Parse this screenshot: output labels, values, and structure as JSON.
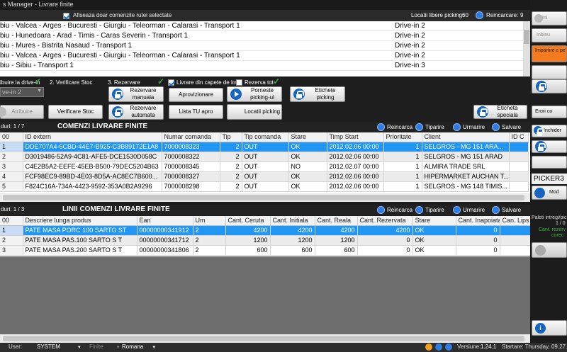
{
  "window": {
    "title": "s Manager - Livrare finite"
  },
  "topbar": {
    "show_selected_only_label": "Afiseaza doar comenzile rutei selectate",
    "free_picking_locations_label": "Locatii libere picking:",
    "free_picking_locations_value": "60",
    "reload_label": "Reincarcare:",
    "reload_value": "9"
  },
  "routes": [
    {
      "route": "biu - Valcea - Arges - Bucuresti - Giurgiu - Teleorman - Calarasi - Transport 1",
      "dock": "Drive-in 2"
    },
    {
      "route": "biu - Hunedoara - Arad - Timis - Caras Severin - Transport 1",
      "dock": "Drive-in 2"
    },
    {
      "route": "biu - Mures - Bistrita Nasaud    - Transport 1",
      "dock": "Drive-in 2"
    },
    {
      "route": "biu - Valcea - Arges - Bucuresti - Giurgiu - Teleorman - Calarasi - Transport 1",
      "dock": "Drive-in 2"
    },
    {
      "route": "biu - Sibiu  - Transport 1",
      "dock": "Drive-in 3"
    },
    {
      "route": "",
      "dock": ""
    }
  ],
  "steps": {
    "step1_label": "ibuire la drive-in",
    "dock_select_value": "ve-in 2",
    "assign_button": "Atribuire",
    "step2_label": "2. Verificare Stoc",
    "check_stock_button": "Verificare Stoc",
    "step3_label": "3. Rezervare",
    "manual_reservation_button": "Rezervare manuala",
    "auto_reservation_button": "Rezervare automata",
    "lot_delivery_label": "Livrare din capete de lot",
    "reserve_all_label": "Rezerva tot",
    "supply_button": "Aprovizionare",
    "tu_list_button": "Lista TU apro",
    "start_picking_button": "Porneste picking-ul",
    "picking_locations_button": "Locatii picking",
    "picking_labels_button": "Etichete picking",
    "special_label_button": "Eticheta speciala"
  },
  "orders": {
    "count_label": "duri:  1  /  7",
    "title": "COMENZI LIVRARE FINITE",
    "tools": [
      "Reincarca",
      "Tiparire",
      "Urmarire",
      "Salvare"
    ],
    "columns": [
      "00",
      "ID extern",
      "Numar comanda",
      "Tip",
      "Tip comanda",
      "Stare",
      "Timp Start",
      "Prioritate",
      "Client",
      "ID C"
    ],
    "rows": [
      [
        "1",
        "DDE707A4-6CBD-44E7-B925-C3B89172E1A8",
        "7000008323",
        "2",
        "OUT",
        "OK",
        "2012.02.06 00:00",
        "1",
        "SELGROS - MG 151 ARA..."
      ],
      [
        "2",
        "D3019486-52A9-4C81-AFE5-DCE1530D058C",
        "7000008322",
        "2",
        "OUT",
        "OK",
        "2012.02.06 00:00",
        "1",
        "SELGROS - MG 151 ARAD"
      ],
      [
        "3",
        "C4E2B5A2-EEFE-45EB-B500-79DEC5204B63",
        "7000008345",
        "2",
        "OUT",
        "NO",
        "2012.02.07 00:00",
        "1",
        "ALMIRA TRADE SRL"
      ],
      [
        "4",
        "FCF98EC9-89BD-4E03-8D5A-AC8EC7B600...",
        "7000008327",
        "2",
        "OUT",
        "OK",
        "2012.02.06 00:00",
        "1",
        "HIPERMARKET AUCHAN T..."
      ],
      [
        "5",
        "F824C16A-734A-4423-9592-353A0B2A9296",
        "7000008298",
        "2",
        "OUT",
        "OK",
        "2012.02.06 00:00",
        "1",
        "SELGROS - MG 148 TIMIS..."
      ]
    ]
  },
  "lines": {
    "count_label": "duri:  1  /  3",
    "title": "LINII COMENZI LIVRARE FINITE",
    "tools": [
      "Reincarca",
      "Tiparire",
      "Urmarire",
      "Salvare"
    ],
    "columns": [
      "00",
      "Descriere lunga produs",
      "Ean",
      "Um",
      "Cant. Ceruta",
      "Cant. Initiala",
      "Cant. Reala",
      "Cant. Rezervata",
      "Stare",
      "Cant. Inapoiata",
      "Can. Lips"
    ],
    "rows": [
      [
        "1",
        "PATE MASA PORC 100 SARTO ST",
        "00000000341912",
        "2",
        "4200",
        "4200",
        "4200",
        "4200",
        "OK",
        "0"
      ],
      [
        "2",
        "PATE MASA PAS.100 SARTO S T",
        "00000000341712",
        "2",
        "1200",
        "1200",
        "1200",
        "0",
        "OK",
        "0"
      ],
      [
        "3",
        "PATE MASA PAS.200 SARTO S T",
        "00000000341806",
        "2",
        "600",
        "600",
        "600",
        "0",
        "OK",
        "0"
      ]
    ]
  },
  "sidebar": {
    "btn1": "Ini",
    "btn2": "Inbinu",
    "btn3": "Impartire c pe",
    "errors_label": "Erori co",
    "close_label": "Inchider",
    "picker": "PICKER3",
    "mod_label": "Mod",
    "pallets_label": "Paleti intregi/pic",
    "pallets_value": "1 / 0",
    "reserved_label": "Cant. rezerv",
    "reserved_value": "corec"
  },
  "status": {
    "user_label": "User:",
    "user_value": "SYSTEM",
    "finite_label": "Finite",
    "language": "Romana",
    "version_label": "Versiune:",
    "version_value": "1.24.1",
    "start_label": "Startare: Thursday, 09.27.2"
  },
  "colors": {
    "selection": "#2196f3",
    "accent": "#1565c0",
    "orange": "#f47a20"
  }
}
